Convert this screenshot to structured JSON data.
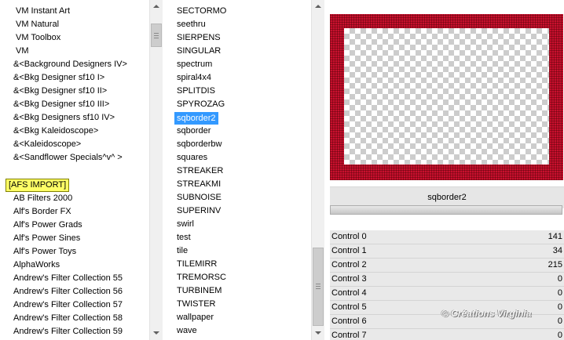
{
  "categories": {
    "items": [
      {
        "label": "VM Instant Art"
      },
      {
        "label": "VM Natural"
      },
      {
        "label": "VM Toolbox"
      },
      {
        "label": "VM"
      },
      {
        "label": "&<Background Designers IV>"
      },
      {
        "label": "&<Bkg Designer sf10 I>"
      },
      {
        "label": "&<Bkg Designer sf10 II>"
      },
      {
        "label": "&<Bkg Designer sf10 III>"
      },
      {
        "label": "&<Bkg Designers sf10 IV>"
      },
      {
        "label": "&<Bkg Kaleidoscope>"
      },
      {
        "label": "&<Kaleidoscope>"
      },
      {
        "label": "&<Sandflower Specials^v^ >"
      },
      {
        "label": ""
      },
      {
        "label": "[AFS IMPORT]"
      },
      {
        "label": "AB Filters 2000"
      },
      {
        "label": "Alf's Border FX"
      },
      {
        "label": "Alf's Power Grads"
      },
      {
        "label": "Alf's Power Sines"
      },
      {
        "label": "Alf's Power Toys"
      },
      {
        "label": "AlphaWorks"
      },
      {
        "label": "Andrew's Filter Collection 55"
      },
      {
        "label": "Andrew's Filter Collection 56"
      },
      {
        "label": "Andrew's Filter Collection 57"
      },
      {
        "label": "Andrew's Filter Collection 58"
      },
      {
        "label": "Andrew's Filter Collection 59"
      }
    ],
    "highlighted": "[AFS IMPORT]"
  },
  "filters": {
    "items": [
      {
        "label": "SECTORMO"
      },
      {
        "label": "seethru"
      },
      {
        "label": "SIERPENS"
      },
      {
        "label": "SINGULAR"
      },
      {
        "label": "spectrum"
      },
      {
        "label": "spiral4x4"
      },
      {
        "label": "SPLITDIS"
      },
      {
        "label": "SPYROZAG"
      },
      {
        "label": "sqborder2"
      },
      {
        "label": "sqborder"
      },
      {
        "label": "sqborderbw"
      },
      {
        "label": "squares"
      },
      {
        "label": "STREAKER"
      },
      {
        "label": "STREAKMI"
      },
      {
        "label": "SUBNOISE"
      },
      {
        "label": "SUPERINV"
      },
      {
        "label": "swirl"
      },
      {
        "label": "test"
      },
      {
        "label": "tile"
      },
      {
        "label": "TILEMIRR"
      },
      {
        "label": "TREMORSC"
      },
      {
        "label": "TURBINEM"
      },
      {
        "label": "TWISTER"
      },
      {
        "label": "wallpaper"
      },
      {
        "label": "wave"
      }
    ],
    "selected": "sqborder2"
  },
  "preview": {
    "title": "sqborder2",
    "frame_color": "#c8102e",
    "progress": 1.0
  },
  "controls": [
    {
      "label": "Control 0",
      "value": "141"
    },
    {
      "label": "Control 1",
      "value": "34"
    },
    {
      "label": "Control 2",
      "value": "215"
    },
    {
      "label": "Control 3",
      "value": "0"
    },
    {
      "label": "Control 4",
      "value": "0"
    },
    {
      "label": "Control 5",
      "value": "0"
    },
    {
      "label": "Control 6",
      "value": "0"
    },
    {
      "label": "Control 7",
      "value": "0"
    }
  ],
  "watermark": "© Créations Virginia",
  "colors": {
    "selection": "#3399ff",
    "highlight": "#ffff66"
  }
}
